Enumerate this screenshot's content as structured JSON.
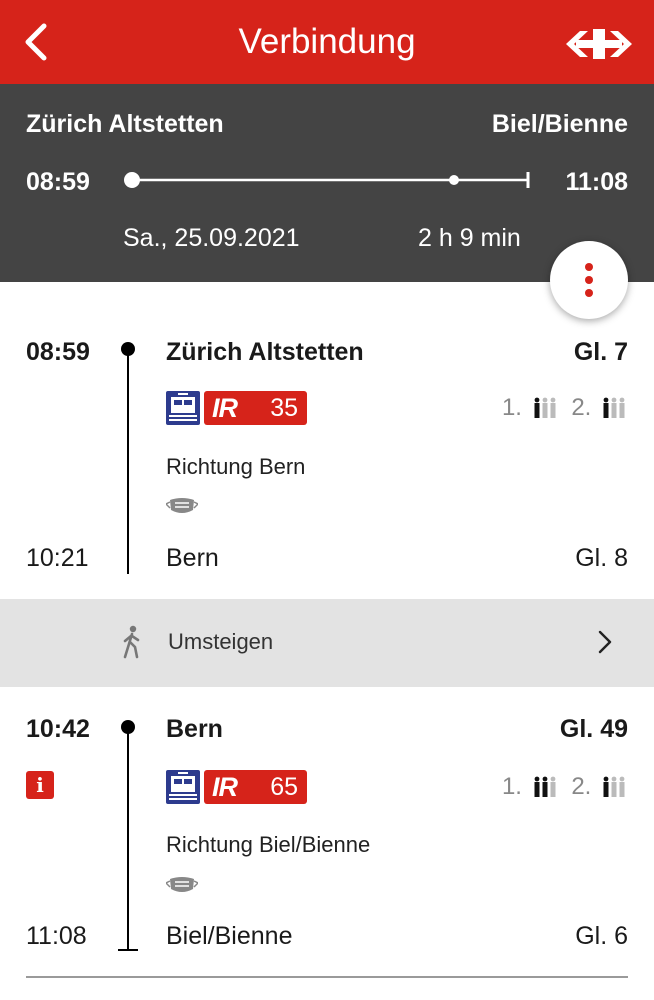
{
  "header": {
    "title": "Verbindung",
    "back_icon": "chevron-left-icon",
    "logo_icon": "sbb-logo-icon",
    "brand_color": "#d6231a"
  },
  "summary": {
    "from": "Zürich Altstetten",
    "to": "Biel/Bienne",
    "departure": "08:59",
    "arrival": "11:08",
    "date": "Sa., 25.09.2021",
    "duration": "2 h 9 min",
    "background_color": "#444444"
  },
  "more_button": {
    "icon": "more-vertical-icon"
  },
  "legs": [
    {
      "departure_time": "08:59",
      "departure_station": "Zürich Altstetten",
      "departure_platform": "Gl. 7",
      "train_type": "IR",
      "train_number": "35",
      "occupancy": {
        "first_class": "1.",
        "second_class": "2."
      },
      "direction": "Richtung Bern",
      "mask_icon": "mask-icon",
      "arrival_time": "10:21",
      "arrival_station": "Bern",
      "arrival_platform": "Gl. 8"
    },
    {
      "departure_time": "10:42",
      "departure_station": "Bern",
      "departure_platform": "Gl. 49",
      "info_label": "i",
      "train_type": "IR",
      "train_number": "65",
      "occupancy": {
        "first_class": "1.",
        "second_class": "2."
      },
      "direction": "Richtung Biel/Bienne",
      "mask_icon": "mask-icon",
      "arrival_time": "11:08",
      "arrival_station": "Biel/Bienne",
      "arrival_platform": "Gl. 6"
    }
  ],
  "transfer": {
    "label": "Umsteigen",
    "icon": "walking-person-icon"
  }
}
